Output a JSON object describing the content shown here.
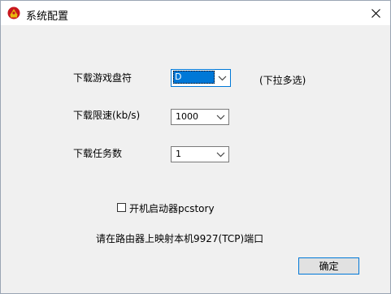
{
  "window": {
    "title": "系统配置"
  },
  "form": {
    "game_drive": {
      "label": "下载游戏盘符",
      "value": "D",
      "hint": "(下拉多选)"
    },
    "speed_limit": {
      "label": "下载限速(kb/s)",
      "value": "1000"
    },
    "task_count": {
      "label": "下载任务数",
      "value": "1"
    },
    "autostart": {
      "label": "开机启动器pcstory",
      "checked": false
    }
  },
  "notice": "请在路由器上映射本机9927(TCP)端口",
  "buttons": {
    "ok": "确定"
  },
  "colors": {
    "accent": "#0078d7",
    "dialog_bg": "#f0f0f0",
    "icon_red": "#c8161d",
    "icon_gold": "#e8b80e"
  }
}
